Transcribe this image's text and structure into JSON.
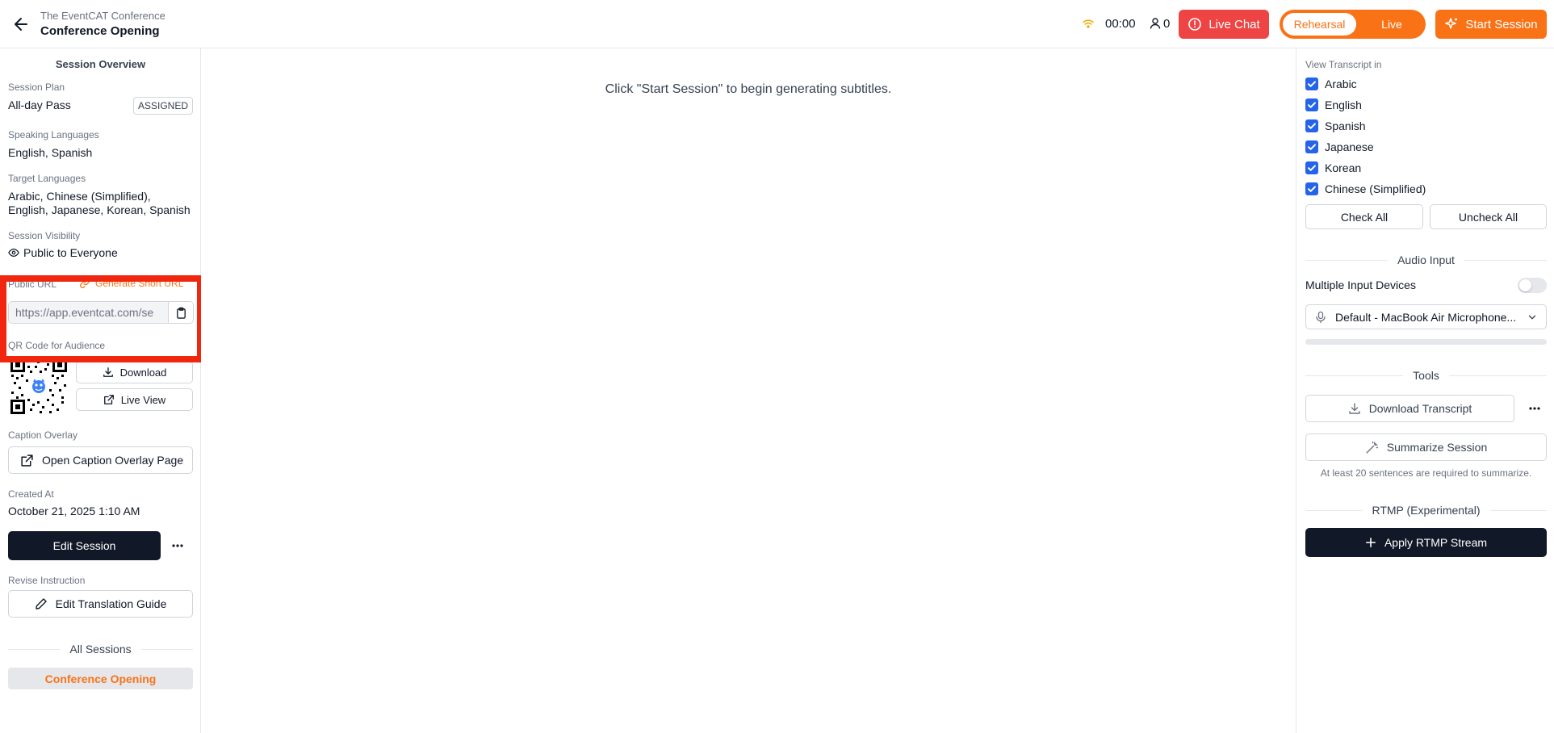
{
  "header": {
    "event_name": "The EventCAT Conference",
    "session_title": "Conference Opening",
    "timer": "00:00",
    "attendee_count": "0",
    "live_chat_label": "Live Chat",
    "mode_rehearsal": "Rehearsal",
    "mode_live": "Live",
    "start_session_label": "Start Session"
  },
  "left": {
    "overview_title": "Session Overview",
    "session_plan_label": "Session Plan",
    "session_plan_value": "All-day Pass",
    "assigned_badge": "ASSIGNED",
    "speaking_label": "Speaking Languages",
    "speaking_value": "English, Spanish",
    "target_label": "Target Languages",
    "target_value_line1": "Arabic, Chinese (Simplified),",
    "target_value_line2": "English, Japanese, Korean, Spanish",
    "visibility_label": "Session Visibility",
    "visibility_value": "Public to Everyone",
    "public_url_label": "Public URL",
    "generate_short_url": "Generate Short URL",
    "url_value": "https://app.eventcat.com/se",
    "qr_label": "QR Code for Audience",
    "download_label": "Download",
    "live_view_label": "Live View",
    "caption_overlay_label": "Caption Overlay",
    "open_caption_label": "Open Caption Overlay Page",
    "created_at_label": "Created At",
    "created_at_value": "October 21, 2025 1:10 AM",
    "edit_session_label": "Edit Session",
    "revise_label": "Revise Instruction",
    "edit_guide_label": "Edit Translation Guide",
    "all_sessions_label": "All Sessions",
    "session_item": "Conference Opening"
  },
  "center": {
    "placeholder": "Click \"Start Session\" to begin generating subtitles."
  },
  "right": {
    "view_transcript_label": "View Transcript in",
    "languages": [
      "Arabic",
      "English",
      "Spanish",
      "Japanese",
      "Korean",
      "Chinese (Simplified)"
    ],
    "check_all": "Check All",
    "uncheck_all": "Uncheck All",
    "audio_input_title": "Audio Input",
    "multiple_devices_label": "Multiple Input Devices",
    "device_selected": "Default - MacBook Air Microphone...",
    "tools_title": "Tools",
    "download_transcript": "Download Transcript",
    "summarize_session": "Summarize Session",
    "summarize_hint": "At least 20 sentences are required to summarize.",
    "rtmp_title": "RTMP (Experimental)",
    "apply_rtmp": "Apply RTMP Stream"
  },
  "colors": {
    "accent": "#f97316",
    "danger": "#ef4444",
    "dark": "#111827",
    "checkbox": "#2563eb",
    "highlight": "#f0260f"
  }
}
